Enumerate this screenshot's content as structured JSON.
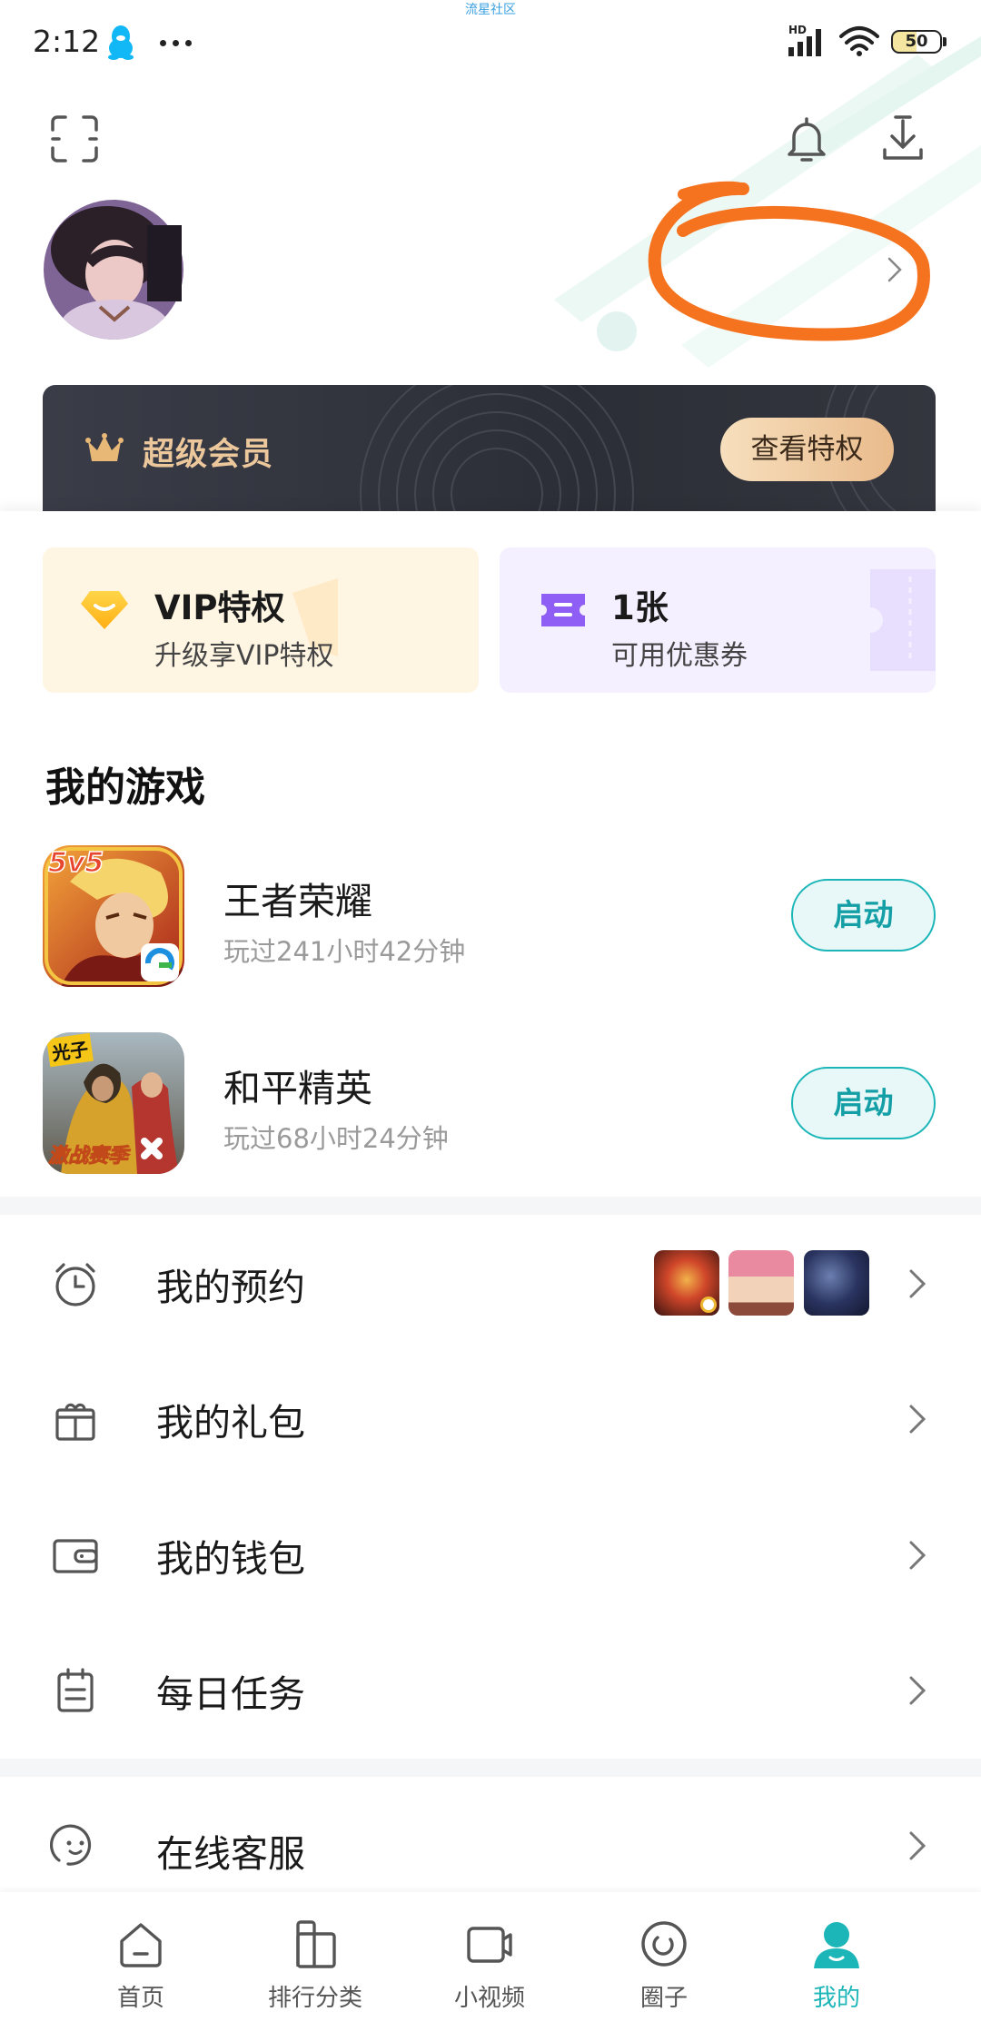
{
  "status_bar": {
    "time": "2:12",
    "network_label": "HD",
    "battery": "50",
    "icons": [
      "qq-penguin-icon",
      "more-dots-icon",
      "signal-icon",
      "wifi-icon",
      "battery-icon"
    ]
  },
  "watermark": "流星社区",
  "header": {
    "icons": [
      "scan-icon",
      "bell-icon",
      "download-icon"
    ]
  },
  "profile": {
    "chevron_icon": "chevron-right-icon"
  },
  "vip_banner": {
    "icon": "crown-icon",
    "title": "超级会员",
    "button_label": "查看特权"
  },
  "benefit_cards": [
    {
      "icon": "vip-diamond-icon",
      "title": "VIP特权",
      "subtitle": "升级享VIP特权"
    },
    {
      "icon": "coupon-icon",
      "title": "1张",
      "subtitle": "可用优惠券"
    }
  ],
  "games": {
    "heading": "我的游戏",
    "items": [
      {
        "name": "王者荣耀",
        "playtime": "玩过241小时42分钟",
        "action_label": "启动",
        "icon_text": "5v5"
      },
      {
        "name": "和平精英",
        "playtime": "玩过68小时24分钟",
        "action_label": "启动",
        "icon_text": "光子",
        "icon_subtext": "激战赛季"
      }
    ]
  },
  "menu": [
    {
      "label": "我的预约",
      "icon": "alarm-clock-icon"
    },
    {
      "label": "我的礼包",
      "icon": "gift-box-icon"
    },
    {
      "label": "我的钱包",
      "icon": "wallet-icon"
    },
    {
      "label": "每日任务",
      "icon": "task-clipboard-icon"
    },
    {
      "label": "在线客服",
      "icon": "customer-service-icon"
    }
  ],
  "bottom_nav": {
    "active_index": 4,
    "items": [
      {
        "label": "首页",
        "icon": "home-icon"
      },
      {
        "label": "排行分类",
        "icon": "ranking-icon"
      },
      {
        "label": "小视频",
        "icon": "video-icon"
      },
      {
        "label": "圈子",
        "icon": "community-circle-icon"
      },
      {
        "label": "我的",
        "icon": "profile-icon"
      }
    ]
  },
  "colors": {
    "accent": "#1cb6b8",
    "annotation": "#f5731f",
    "vip_gold": "#ecc79c",
    "vip_dark": "#30323c",
    "card_vip_bg": "#fff5e3",
    "card_coupon_bg": "#f4f0ff",
    "text_primary": "#1a1a1a",
    "text_secondary": "#9a9a9a"
  }
}
